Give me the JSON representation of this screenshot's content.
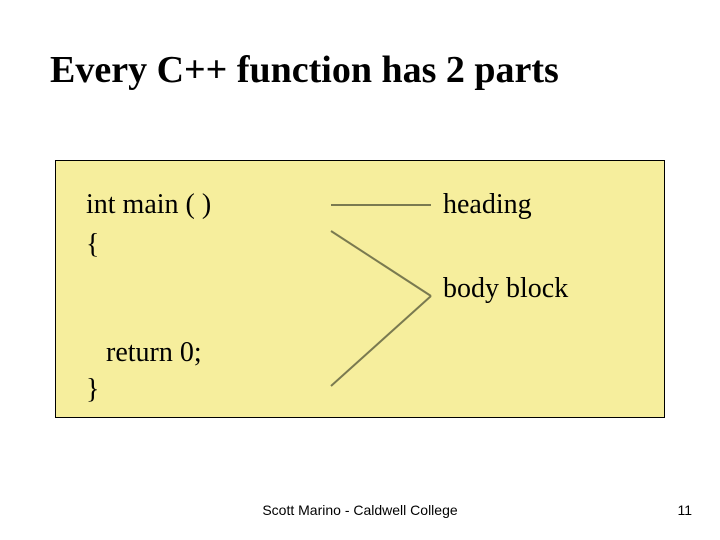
{
  "title": "Every C++ function has 2 parts",
  "code": {
    "line1": "int main (  )",
    "line2": "{",
    "line3": "return 0;",
    "line4": "}"
  },
  "labels": {
    "heading": "heading",
    "body": "body block"
  },
  "footer": "Scott Marino - Caldwell College",
  "page_number": "11"
}
